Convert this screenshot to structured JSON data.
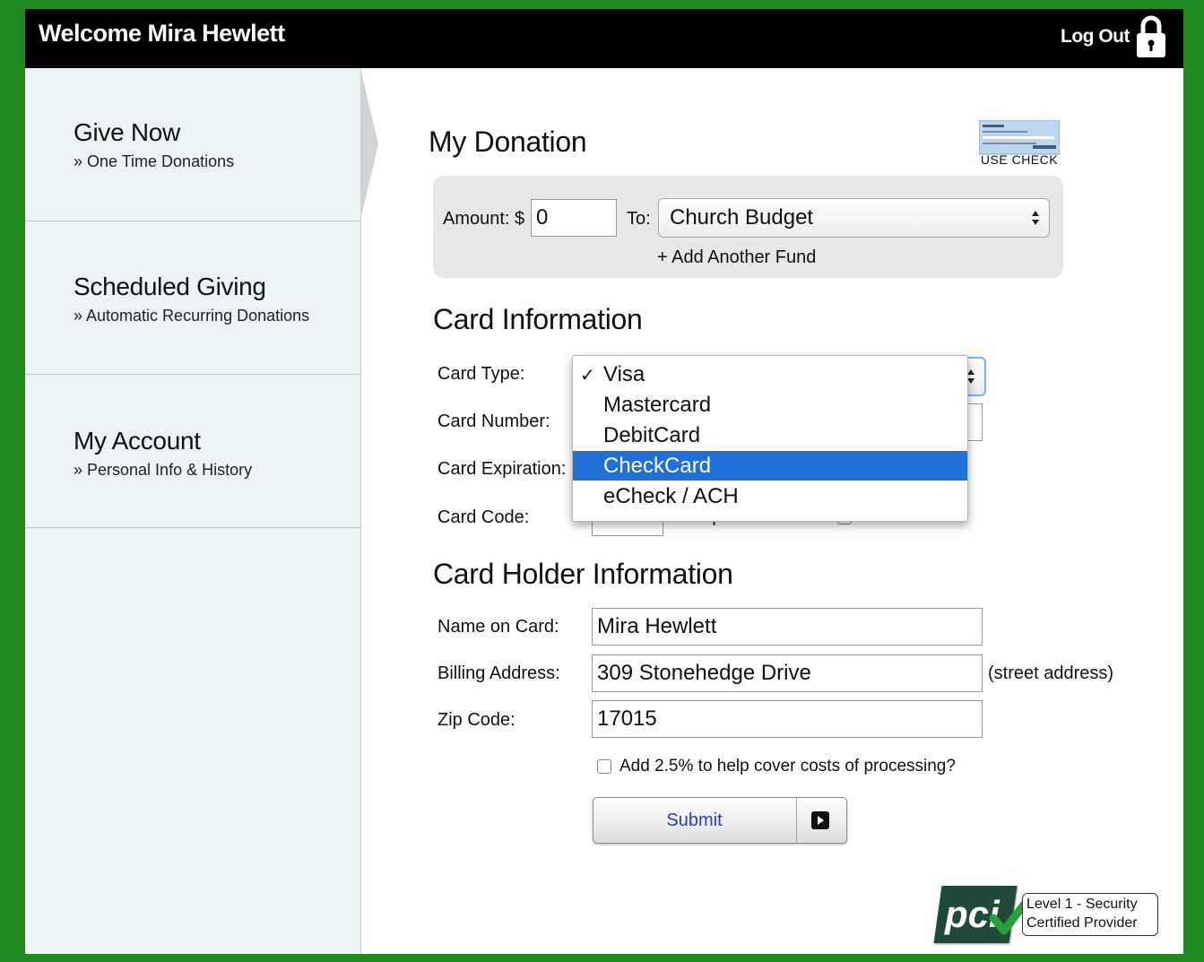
{
  "header": {
    "welcome": "Welcome Mira Hewlett",
    "logout_label": "Log Out"
  },
  "sidebar": {
    "items": [
      {
        "title": "Give Now",
        "subtitle": "» One Time Donations"
      },
      {
        "title": "Scheduled Giving",
        "subtitle": "» Automatic Recurring Donations"
      },
      {
        "title": "My Account",
        "subtitle": "» Personal Info & History"
      }
    ]
  },
  "donation": {
    "title": "My Donation",
    "use_check_label": "USE CHECK",
    "amount_label": "Amount: $",
    "amount_value": "0",
    "to_label": "To:",
    "fund_selected": "Church Budget",
    "add_fund": "+ Add Another Fund"
  },
  "card": {
    "title": "Card Information",
    "type_label": "Card Type:",
    "number_label": "Card Number:",
    "expiration_label": "Card Expiration:",
    "code_label": "Card Code:",
    "type_options": [
      "Visa",
      "Mastercard",
      "DebitCard",
      "CheckCard",
      "eCheck / ACH"
    ],
    "selected_option": "Visa",
    "highlighted_option": "CheckCard",
    "code_help": "« Help?",
    "save_card_label": "Save this card"
  },
  "holder": {
    "title": "Card Holder Information",
    "name_label": "Name on Card:",
    "name_value": "Mira Hewlett",
    "address_label": "Billing Address:",
    "address_value": "309 Stonehedge Drive",
    "address_hint": "(street address)",
    "zip_label": "Zip Code:",
    "zip_value": "17015",
    "fee_label": "Add 2.5% to help cover costs of processing?",
    "submit_label": "Submit"
  },
  "badge": {
    "logo": "pci",
    "line1": "Level 1 - Security",
    "line2": "Certified Provider"
  },
  "colors": {
    "frame": "#1f8a1f",
    "highlight": "#2070d8",
    "submit_text": "#1f3fd0",
    "pci_dark": "#1f4a3a",
    "check_green": "#22a33a"
  }
}
